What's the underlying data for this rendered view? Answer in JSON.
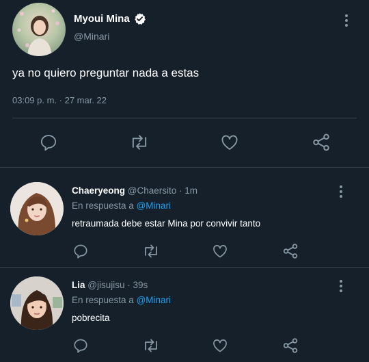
{
  "main_tweet": {
    "author_name": "Myoui Mina",
    "handle": "@Minari",
    "verified": true,
    "text": "ya no quiero preguntar nada a estas",
    "timestamp": "03:09 p. m. · 27 mar. 22"
  },
  "replies": [
    {
      "author_name": "Chaeryeong",
      "handle": "@Chaersito",
      "time": "· 1m",
      "reply_prefix": "En respuesta a",
      "reply_to": "@Minari",
      "text": "retraumada debe estar Mina por convivir tanto"
    },
    {
      "author_name": "Lia",
      "handle": "@jisujisu",
      "time": "· 39s",
      "reply_prefix": "En respuesta a",
      "reply_to": "@Minari",
      "text": "pobrecita"
    }
  ],
  "icons": [
    "reply-icon",
    "retweet-icon",
    "like-icon",
    "share-icon",
    "more-icon",
    "verified-badge-icon"
  ],
  "colors": {
    "background": "#15202b",
    "text": "#ffffff",
    "muted": "#8899a6",
    "link": "#1da1f2",
    "divider": "#38444d"
  }
}
